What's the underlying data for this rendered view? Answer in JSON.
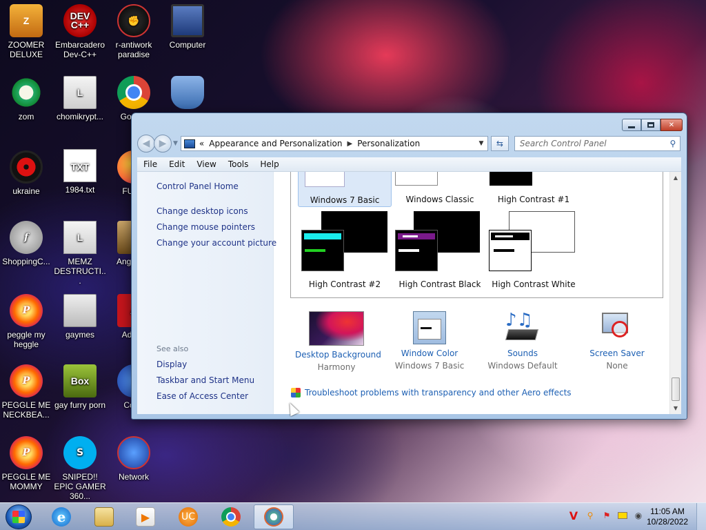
{
  "desktop": {
    "icons": [
      {
        "label": "ZOOMER DELUXE",
        "icon": "zoomer-app-icon"
      },
      {
        "label": "Embarcadero Dev-C++",
        "icon": "dev-cpp-icon",
        "badge": "DEV C++"
      },
      {
        "label": "r-antiwork paradise",
        "icon": "antiwork-icon"
      },
      {
        "label": "Computer",
        "icon": "computer-icon"
      },
      {
        "label": "zom",
        "icon": "zom-icon"
      },
      {
        "label": "chomikrypt...",
        "icon": "chomikrypt-icon"
      },
      {
        "label": "Go Chr",
        "icon": "chrome-icon"
      },
      {
        "label": "",
        "icon": "user-folder-icon"
      },
      {
        "label": "ukraine",
        "icon": "radiation-icon"
      },
      {
        "label": "1984.txt",
        "icon": "text-file-icon"
      },
      {
        "label": "FURR",
        "icon": "firefox-icon"
      },
      {
        "label": "ShoppingC...",
        "icon": "flash-icon"
      },
      {
        "label": "MEMZ DESTRUCTI...",
        "icon": "memz-icon"
      },
      {
        "label": "Angr Sea",
        "icon": "angry-birds-icon"
      },
      {
        "label": "peggle my heggle",
        "icon": "peggle-icon"
      },
      {
        "label": "gaymes",
        "icon": "games-folder-icon"
      },
      {
        "label": "Adobe",
        "icon": "adobe-icon"
      },
      {
        "label": "PEGGLE ME NECKBEA...",
        "icon": "peggle-icon"
      },
      {
        "label": "gay furry porn",
        "icon": "box-icon",
        "badge": "Box"
      },
      {
        "label": "Contr",
        "icon": "control-panel-icon"
      },
      {
        "label": "PEGGLE ME MOMMY",
        "icon": "peggle-icon"
      },
      {
        "label": "SNIPED!! EPIC GAMER 360...",
        "icon": "skype-icon"
      },
      {
        "label": "Network",
        "icon": "network-icon"
      }
    ]
  },
  "window": {
    "breadcrumb_prefix": "«",
    "breadcrumb": [
      "Appearance and Personalization",
      "Personalization"
    ],
    "search_placeholder": "Search Control Panel",
    "menu": [
      "File",
      "Edit",
      "View",
      "Tools",
      "Help"
    ],
    "left_pane": {
      "home": "Control Panel Home",
      "links": [
        "Change desktop icons",
        "Change mouse pointers",
        "Change your account picture"
      ],
      "see_also_title": "See also",
      "see_also": [
        "Display",
        "Taskbar and Start Menu",
        "Ease of Access Center"
      ]
    },
    "themes": [
      {
        "name": "Windows 7 Basic",
        "selected": true
      },
      {
        "name": "Windows Classic",
        "selected": false
      },
      {
        "name": "High Contrast #1",
        "selected": false
      },
      {
        "name": "High Contrast #2",
        "selected": false
      },
      {
        "name": "High Contrast Black",
        "selected": false
      },
      {
        "name": "High Contrast White",
        "selected": false
      }
    ],
    "customize": [
      {
        "title": "Desktop Background",
        "value": "Harmony",
        "icon": "wallpaper-thumbnail"
      },
      {
        "title": "Window Color",
        "value": "Windows 7 Basic",
        "icon": "window-color-icon"
      },
      {
        "title": "Sounds",
        "value": "Windows Default",
        "icon": "sounds-icon"
      },
      {
        "title": "Screen Saver",
        "value": "None",
        "icon": "screen-saver-icon"
      }
    ],
    "troubleshoot": "Troubleshoot problems with transparency and other Aero effects"
  },
  "taskbar": {
    "clock_time": "11:05 AM",
    "clock_date": "10/28/2022",
    "pinned": [
      "internet-explorer-icon",
      "windows-explorer-icon",
      "media-player-icon",
      "uc-browser-icon",
      "chrome-icon",
      "control-panel-icon"
    ]
  },
  "colors": {
    "link": "#1c5fb3",
    "nav_link": "#1e3287",
    "window_frame": "#a9c6e6"
  }
}
